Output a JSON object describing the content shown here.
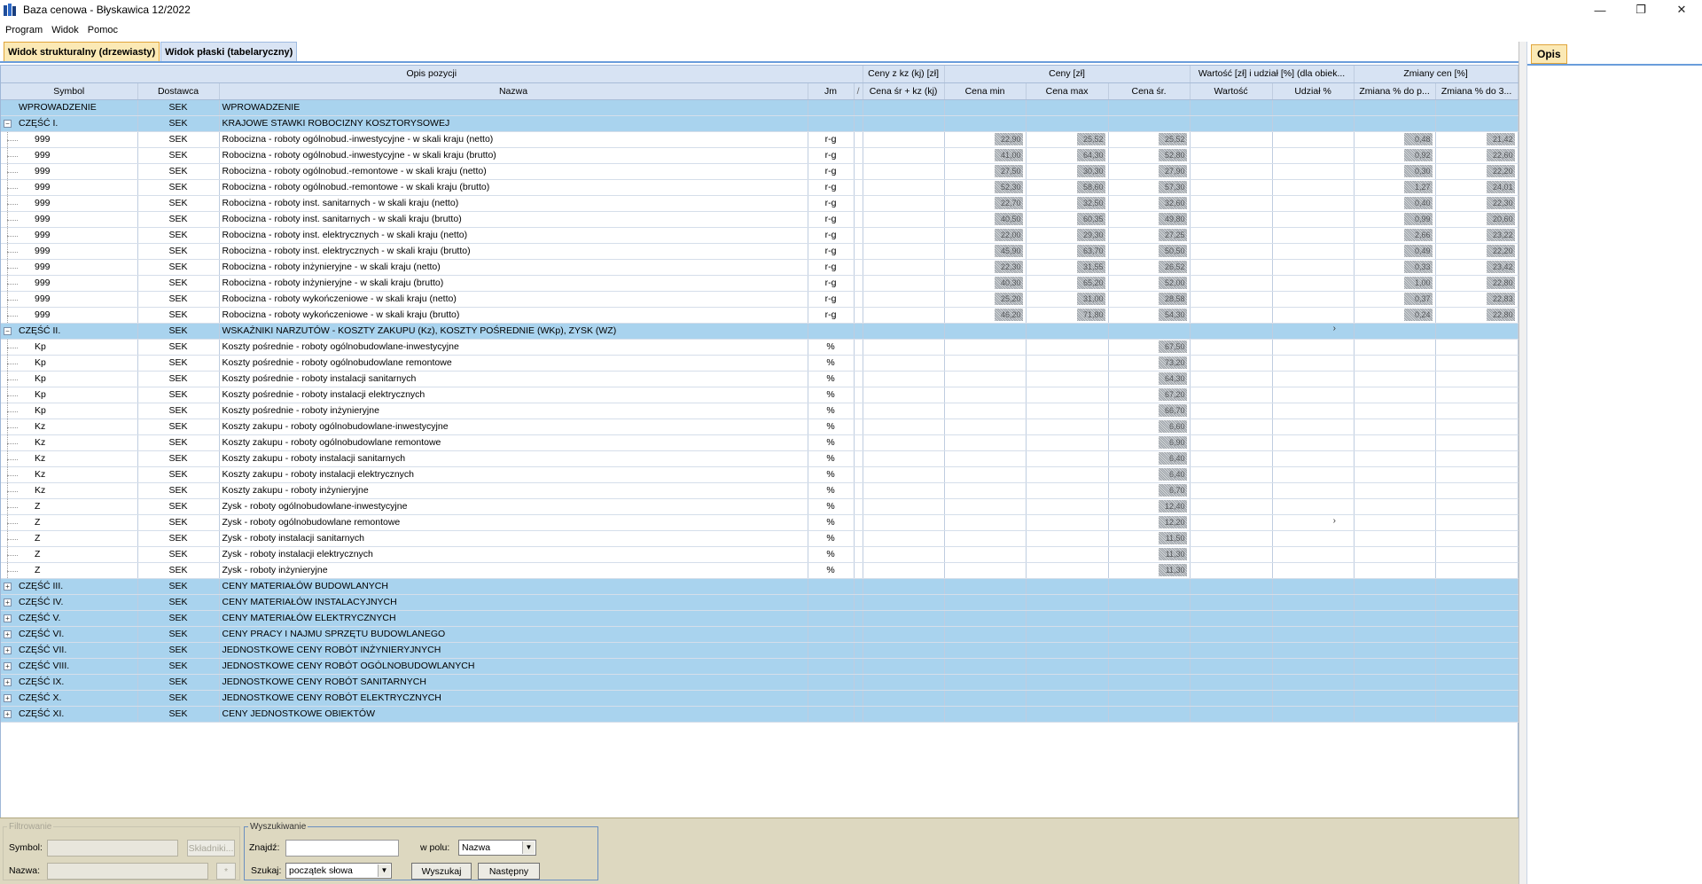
{
  "window": {
    "title": "Baza cenowa - Błyskawica 12/2022",
    "min": "—",
    "restore": "❐",
    "close": "✕"
  },
  "menu": [
    "Program",
    "Widok",
    "Pomoc"
  ],
  "tabs": {
    "active": "Widok strukturalny (drzewiasty)",
    "inactive": "Widok płaski (tabelaryczny)"
  },
  "header_groups": {
    "opis": "Opis pozycji",
    "ceny_kz": "Ceny z kz (kj) [zł]",
    "ceny": "Ceny [zł]",
    "wartosc": "Wartość [zł] i udział [%] (dla obiek...",
    "zmiany": "Zmiany cen [%]"
  },
  "columns": {
    "symbol": "Symbol",
    "dostawca": "Dostawca",
    "nazwa": "Nazwa",
    "jm": "Jm",
    "sort": "/",
    "cena_sr_kz": "Cena śr + kz (kj)",
    "cena_min": "Cena min",
    "cena_max": "Cena max",
    "cena_sr": "Cena śr.",
    "wartosc": "Wartość",
    "udzial": "Udział %",
    "zm1": "Zmiana % do p...",
    "zm2": "Zmiana % do 3..."
  },
  "rows": [
    {
      "type": "group",
      "exp": "",
      "symbol": "WPROWADZENIE",
      "dostawca": "SEK",
      "nazwa": "WPROWADZENIE",
      "jm": "",
      "mn": "",
      "mx": "",
      "sr": "",
      "z1": "",
      "z2": ""
    },
    {
      "type": "group",
      "exp": "−",
      "symbol": "CZĘŚĆ I.",
      "dostawca": "SEK",
      "nazwa": "KRAJOWE STAWKI ROBOCIZNY KOSZTORYSOWEJ",
      "jm": "",
      "mn": "",
      "mx": "",
      "sr": "",
      "z1": "",
      "z2": ""
    },
    {
      "type": "item",
      "symbol": "999",
      "dostawca": "SEK",
      "nazwa": "Robocizna - roboty ogólnobud.-inwestycyjne - w skali kraju (netto)",
      "jm": "r-g",
      "mn": "22,90",
      "mx": "25,52",
      "sr": "25,52",
      "z1": "0,48",
      "z2": "21,42"
    },
    {
      "type": "item",
      "symbol": "999",
      "dostawca": "SEK",
      "nazwa": "Robocizna - roboty ogólnobud.-inwestycyjne - w skali kraju (brutto)",
      "jm": "r-g",
      "mn": "41,00",
      "mx": "64,30",
      "sr": "52,80",
      "z1": "0,92",
      "z2": "22,60"
    },
    {
      "type": "item",
      "symbol": "999",
      "dostawca": "SEK",
      "nazwa": "Robocizna - roboty ogólnobud.-remontowe - w skali kraju (netto)",
      "jm": "r-g",
      "mn": "27,50",
      "mx": "30,30",
      "sr": "27,90",
      "z1": "0,30",
      "z2": "22,20"
    },
    {
      "type": "item",
      "symbol": "999",
      "dostawca": "SEK",
      "nazwa": "Robocizna - roboty ogólnobud.-remontowe - w skali kraju (brutto)",
      "jm": "r-g",
      "mn": "52,30",
      "mx": "58,60",
      "sr": "57,30",
      "z1": "1,27",
      "z2": "24,01"
    },
    {
      "type": "item",
      "symbol": "999",
      "dostawca": "SEK",
      "nazwa": "Robocizna - roboty inst. sanitarnych - w skali kraju (netto)",
      "jm": "r-g",
      "mn": "22,70",
      "mx": "32,50",
      "sr": "32,60",
      "z1": "0,40",
      "z2": "22,30"
    },
    {
      "type": "item",
      "symbol": "999",
      "dostawca": "SEK",
      "nazwa": "Robocizna - roboty inst. sanitarnych - w skali kraju (brutto)",
      "jm": "r-g",
      "mn": "40,50",
      "mx": "60,35",
      "sr": "49,80",
      "z1": "0,99",
      "z2": "20,60"
    },
    {
      "type": "item",
      "symbol": "999",
      "dostawca": "SEK",
      "nazwa": "Robocizna - roboty inst. elektrycznych - w skali kraju (netto)",
      "jm": "r-g",
      "mn": "22,00",
      "mx": "29,30",
      "sr": "27,25",
      "z1": "2,66",
      "z2": "23,22"
    },
    {
      "type": "item",
      "symbol": "999",
      "dostawca": "SEK",
      "nazwa": "Robocizna - roboty inst. elektrycznych - w skali kraju (brutto)",
      "jm": "r-g",
      "mn": "45,90",
      "mx": "63,70",
      "sr": "50,50",
      "z1": "0,49",
      "z2": "22,20"
    },
    {
      "type": "item",
      "symbol": "999",
      "dostawca": "SEK",
      "nazwa": "Robocizna - roboty inżynieryjne - w skali kraju (netto)",
      "jm": "r-g",
      "mn": "22,30",
      "mx": "31,55",
      "sr": "26,52",
      "z1": "0,33",
      "z2": "23,42"
    },
    {
      "type": "item",
      "symbol": "999",
      "dostawca": "SEK",
      "nazwa": "Robocizna - roboty inżynieryjne - w skali kraju (brutto)",
      "jm": "r-g",
      "mn": "40,30",
      "mx": "65,20",
      "sr": "52,00",
      "z1": "1,00",
      "z2": "22,80"
    },
    {
      "type": "item",
      "symbol": "999",
      "dostawca": "SEK",
      "nazwa": "Robocizna - roboty wykończeniowe - w skali kraju (netto)",
      "jm": "r-g",
      "mn": "25,20",
      "mx": "31,00",
      "sr": "28,58",
      "z1": "0,37",
      "z2": "22,83"
    },
    {
      "type": "item",
      "symbol": "999",
      "dostawca": "SEK",
      "nazwa": "Robocizna - roboty wykończeniowe - w skali kraju (brutto)",
      "jm": "r-g",
      "mn": "46,20",
      "mx": "71,80",
      "sr": "54,30",
      "z1": "0,24",
      "z2": "22,80"
    },
    {
      "type": "group",
      "exp": "−",
      "symbol": "CZĘŚĆ II.",
      "dostawca": "SEK",
      "nazwa": "WSKAŹNIKI NARZUTÓW - KOSZTY ZAKUPU (Kz), KOSZTY POŚREDNIE (WKp), ZYSK (WZ)",
      "jm": "",
      "mn": "",
      "mx": "",
      "sr": "",
      "z1": "",
      "z2": ""
    },
    {
      "type": "item",
      "symbol": "Kp",
      "dostawca": "SEK",
      "nazwa": "Koszty pośrednie - roboty ogólnobudowlane-inwestycyjne",
      "jm": "%",
      "mn": "",
      "mx": "",
      "sr": "67,50",
      "z1": "",
      "z2": ""
    },
    {
      "type": "item",
      "symbol": "Kp",
      "dostawca": "SEK",
      "nazwa": "Koszty pośrednie - roboty ogólnobudowlane remontowe",
      "jm": "%",
      "mn": "",
      "mx": "",
      "sr": "73,20",
      "z1": "",
      "z2": ""
    },
    {
      "type": "item",
      "symbol": "Kp",
      "dostawca": "SEK",
      "nazwa": "Koszty pośrednie - roboty instalacji sanitarnych",
      "jm": "%",
      "mn": "",
      "mx": "",
      "sr": "64,30",
      "z1": "",
      "z2": ""
    },
    {
      "type": "item",
      "symbol": "Kp",
      "dostawca": "SEK",
      "nazwa": "Koszty pośrednie - roboty instalacji elektrycznych",
      "jm": "%",
      "mn": "",
      "mx": "",
      "sr": "67,20",
      "z1": "",
      "z2": ""
    },
    {
      "type": "item",
      "symbol": "Kp",
      "dostawca": "SEK",
      "nazwa": "Koszty pośrednie - roboty inżynieryjne",
      "jm": "%",
      "mn": "",
      "mx": "",
      "sr": "66,70",
      "z1": "",
      "z2": ""
    },
    {
      "type": "item",
      "symbol": "Kz",
      "dostawca": "SEK",
      "nazwa": "Koszty zakupu - roboty ogólnobudowlane-inwestycyjne",
      "jm": "%",
      "mn": "",
      "mx": "",
      "sr": "6,60",
      "z1": "",
      "z2": ""
    },
    {
      "type": "item",
      "symbol": "Kz",
      "dostawca": "SEK",
      "nazwa": "Koszty zakupu - roboty ogólnobudowlane remontowe",
      "jm": "%",
      "mn": "",
      "mx": "",
      "sr": "6,90",
      "z1": "",
      "z2": ""
    },
    {
      "type": "item",
      "symbol": "Kz",
      "dostawca": "SEK",
      "nazwa": "Koszty zakupu - roboty instalacji sanitarnych",
      "jm": "%",
      "mn": "",
      "mx": "",
      "sr": "6,40",
      "z1": "",
      "z2": ""
    },
    {
      "type": "item",
      "symbol": "Kz",
      "dostawca": "SEK",
      "nazwa": "Koszty zakupu - roboty instalacji elektrycznych",
      "jm": "%",
      "mn": "",
      "mx": "",
      "sr": "6,40",
      "z1": "",
      "z2": ""
    },
    {
      "type": "item",
      "symbol": "Kz",
      "dostawca": "SEK",
      "nazwa": "Koszty zakupu - roboty inżynieryjne",
      "jm": "%",
      "mn": "",
      "mx": "",
      "sr": "6,70",
      "z1": "",
      "z2": ""
    },
    {
      "type": "item",
      "symbol": "Z",
      "dostawca": "SEK",
      "nazwa": "Zysk - roboty ogólnobudowlane-inwestycyjne",
      "jm": "%",
      "mn": "",
      "mx": "",
      "sr": "12,40",
      "z1": "",
      "z2": ""
    },
    {
      "type": "item",
      "symbol": "Z",
      "dostawca": "SEK",
      "nazwa": "Zysk - roboty ogólnobudowlane remontowe",
      "jm": "%",
      "mn": "",
      "mx": "",
      "sr": "12,20",
      "z1": "",
      "z2": ""
    },
    {
      "type": "item",
      "symbol": "Z",
      "dostawca": "SEK",
      "nazwa": "Zysk - roboty instalacji sanitarnych",
      "jm": "%",
      "mn": "",
      "mx": "",
      "sr": "11,50",
      "z1": "",
      "z2": ""
    },
    {
      "type": "item",
      "symbol": "Z",
      "dostawca": "SEK",
      "nazwa": "Zysk - roboty instalacji elektrycznych",
      "jm": "%",
      "mn": "",
      "mx": "",
      "sr": "11,30",
      "z1": "",
      "z2": ""
    },
    {
      "type": "item",
      "symbol": "Z",
      "dostawca": "SEK",
      "nazwa": "Zysk - roboty inżynieryjne",
      "jm": "%",
      "mn": "",
      "mx": "",
      "sr": "11,30",
      "z1": "",
      "z2": ""
    },
    {
      "type": "group",
      "exp": "+",
      "symbol": "CZĘŚĆ III.",
      "dostawca": "SEK",
      "nazwa": "CENY MATERIAŁÓW BUDOWLANYCH",
      "jm": "",
      "mn": "",
      "mx": "",
      "sr": "",
      "z1": "",
      "z2": ""
    },
    {
      "type": "group",
      "exp": "+",
      "symbol": "CZĘŚĆ IV.",
      "dostawca": "SEK",
      "nazwa": "CENY MATERIAŁÓW INSTALACYJNYCH",
      "jm": "",
      "mn": "",
      "mx": "",
      "sr": "",
      "z1": "",
      "z2": ""
    },
    {
      "type": "group",
      "exp": "+",
      "symbol": "CZĘŚĆ V.",
      "dostawca": "SEK",
      "nazwa": "CENY MATERIAŁÓW ELEKTRYCZNYCH",
      "jm": "",
      "mn": "",
      "mx": "",
      "sr": "",
      "z1": "",
      "z2": ""
    },
    {
      "type": "group",
      "exp": "+",
      "symbol": "CZĘŚĆ VI.",
      "dostawca": "SEK",
      "nazwa": "CENY PRACY I NAJMU SPRZĘTU BUDOWLANEGO",
      "jm": "",
      "mn": "",
      "mx": "",
      "sr": "",
      "z1": "",
      "z2": ""
    },
    {
      "type": "group",
      "exp": "+",
      "symbol": "CZĘŚĆ VII.",
      "dostawca": "SEK",
      "nazwa": "JEDNOSTKOWE CENY ROBÓT INŻYNIERYJNYCH",
      "jm": "",
      "mn": "",
      "mx": "",
      "sr": "",
      "z1": "",
      "z2": ""
    },
    {
      "type": "group",
      "exp": "+",
      "symbol": "CZĘŚĆ VIII.",
      "dostawca": "SEK",
      "nazwa": "JEDNOSTKOWE CENY ROBÓT OGÓLNOBUDOWLANYCH",
      "jm": "",
      "mn": "",
      "mx": "",
      "sr": "",
      "z1": "",
      "z2": ""
    },
    {
      "type": "group",
      "exp": "+",
      "symbol": "CZĘŚĆ IX.",
      "dostawca": "SEK",
      "nazwa": "JEDNOSTKOWE CENY ROBÓT SANITARNYCH",
      "jm": "",
      "mn": "",
      "mx": "",
      "sr": "",
      "z1": "",
      "z2": ""
    },
    {
      "type": "group",
      "exp": "+",
      "symbol": "CZĘŚĆ X.",
      "dostawca": "SEK",
      "nazwa": "JEDNOSTKOWE CENY ROBÓT ELEKTRYCZNYCH",
      "jm": "",
      "mn": "",
      "mx": "",
      "sr": "",
      "z1": "",
      "z2": ""
    },
    {
      "type": "group",
      "exp": "+",
      "symbol": "CZĘŚĆ XI.",
      "dostawca": "SEK",
      "nazwa": "CENY JEDNOSTKOWE OBIEKTÓW",
      "jm": "",
      "mn": "",
      "mx": "",
      "sr": "",
      "z1": "",
      "z2": ""
    }
  ],
  "filter": {
    "legend": "Filtrowanie",
    "symbol_label": "Symbol:",
    "symbol_value": "",
    "skladniki_label": "Składniki...",
    "nazwa_label": "Nazwa:",
    "nazwa_value": "",
    "nazwa_btn": "*"
  },
  "search": {
    "legend": "Wyszukiwanie",
    "znajdz_label": "Znajdź:",
    "znajdz_value": "",
    "w_polu_label": "w polu:",
    "w_polu_value": "Nazwa",
    "szukaj_label": "Szukaj:",
    "szukaj_value": "początek słowa",
    "wyszukaj_label": "Wyszukaj",
    "nastepny_label": "Następny"
  },
  "right_panel": {
    "tab": "Opis"
  },
  "colors": {
    "group_row": "#a9d3ee",
    "header": "#d7e3f3",
    "active_tab": "#fbe9b5",
    "bottom_panel": "#ddd8c0"
  }
}
